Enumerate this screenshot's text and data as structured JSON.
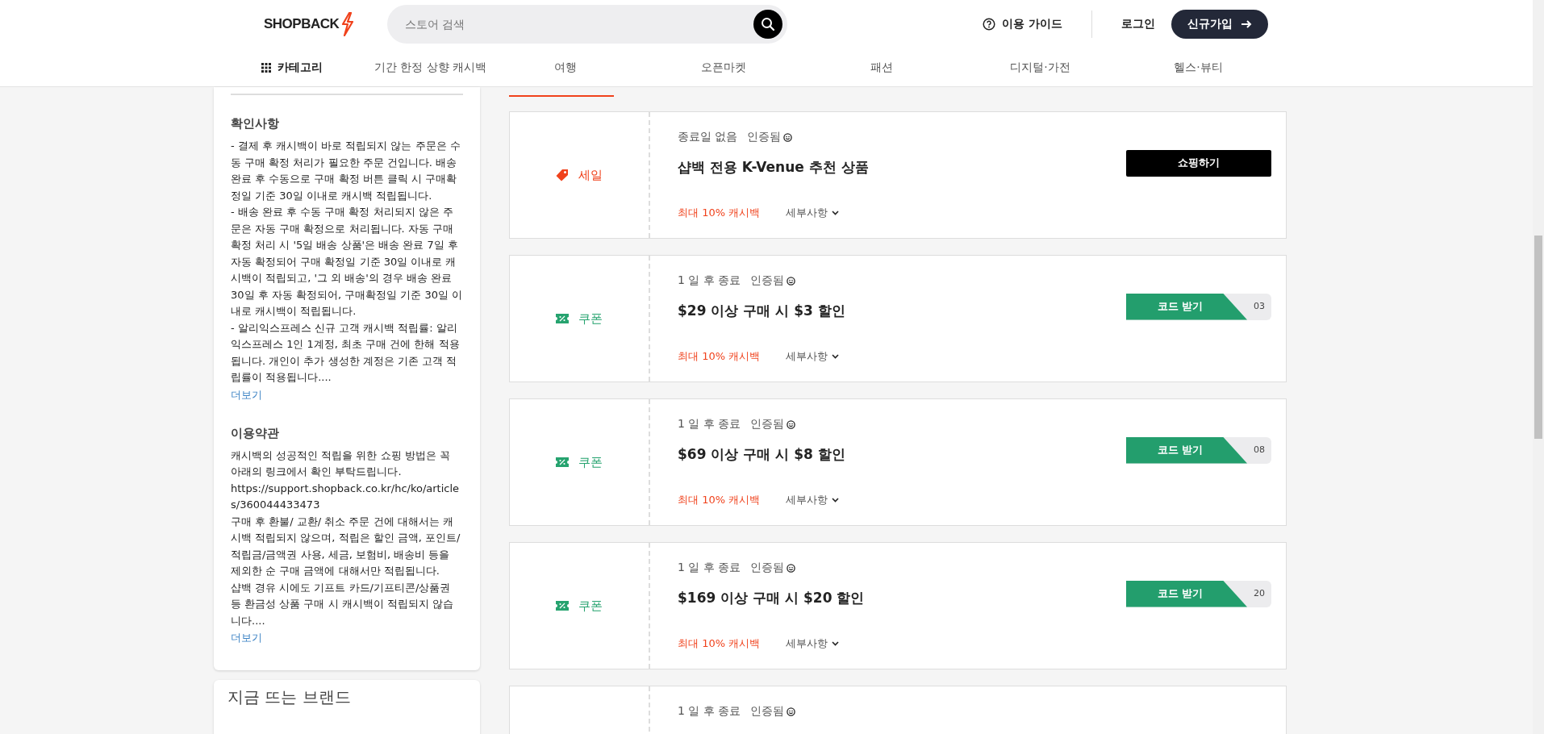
{
  "header": {
    "logo": "SHOPBACK",
    "search": {
      "placeholder": "스토어 검색"
    },
    "guide": "이용 가이드",
    "login": "로그인",
    "signup": "신규가입"
  },
  "nav": {
    "category": "카테고리",
    "items": [
      "기간 한정 상향 캐시백",
      "여행",
      "오픈마켓",
      "패션",
      "디지털·가전",
      "헬스·뷰티"
    ]
  },
  "sidebar": {
    "sections": [
      {
        "title": "확인사항",
        "lines": [
          "- 결제 후 캐시백이 바로 적립되지 않는 주문은 수동 구매 확정 처리가 필요한 주문 건입니다. 배송 완료 후 수동으로 구매 확정 버튼 클릭 시 구매확정일 기준 30일 이내로 캐시백 적립됩니다.",
          "- 배송 완료 후 수동 구매 확정 처리되지 않은 주문은 자동 구매 확정으로 처리됩니다. 자동 구매 확정 처리 시 '5일 배송 상품'은 배송 완료 7일 후 자동 확정되어 구매 확정일 기준 30일 이내로 캐시백이 적립되고, '그 외 배송'의 경우 배송 완료 30일 후 자동 확정되어, 구매확정일 기준 30일 이내로 캐시백이 적립됩니다.",
          "- 알리익스프레스 신규 고객 캐시백 적립률: 알리익스프레스 1인 1계정, 최초 구매 건에 한해 적용됩니다. 개인이 추가 생성한 계정은 기존 고객 적립률이 적용됩니다...."
        ],
        "more": "더보기"
      },
      {
        "title": "이용약관",
        "lines": [
          "캐시백의 성공적인 적립을 위한 쇼핑 방법은 꼭 아래의 링크에서 확인 부탁드립니다.",
          "https://support.shopback.co.kr/hc/ko/articles/360044433473",
          "구매 후 환불/ 교환/ 취소 주문 건에 대해서는 캐시백 적립되지 않으며, 적립은 할인 금액, 포인트/적립금/금액권 사용, 세금, 보험비, 배송비 등을 제외한 순 구매 금액에 대해서만 적립됩니다.",
          "샵백 경유 시에도 기프트 카드/기프티콘/상품권 등 환금성 상품 구매 시 캐시백이 적립되지 않습니다...."
        ],
        "more": "더보기"
      }
    ],
    "trending_title": "지금 뜨는 브랜드"
  },
  "offers": [
    {
      "kind": "sale",
      "type_label": "세일",
      "expiry": "종료일 없음",
      "verified": "인증됨",
      "title": "샵백 전용 K-Venue 추천 상품",
      "cashback": "최대 10% 캐시백",
      "details": "세부사항",
      "action": "쇼핑하기"
    },
    {
      "kind": "coupon",
      "type_label": "쿠폰",
      "expiry": "1 일 후 종료",
      "verified": "인증됨",
      "title": "$29 이상 구매 시 $3 할인",
      "cashback": "최대 10% 캐시백",
      "details": "세부사항",
      "action": "코드 받기",
      "code_peek": "03"
    },
    {
      "kind": "coupon",
      "type_label": "쿠폰",
      "expiry": "1 일 후 종료",
      "verified": "인증됨",
      "title": "$69 이상 구매 시 $8 할인",
      "cashback": "최대 10% 캐시백",
      "details": "세부사항",
      "action": "코드 받기",
      "code_peek": "08"
    },
    {
      "kind": "coupon",
      "type_label": "쿠폰",
      "expiry": "1 일 후 종료",
      "verified": "인증됨",
      "title": "$169 이상 구매 시 $20 할인",
      "cashback": "최대 10% 캐시백",
      "details": "세부사항",
      "action": "코드 받기",
      "code_peek": "20"
    },
    {
      "expiry": "1 일 후 종료",
      "verified": "인증됨"
    }
  ]
}
